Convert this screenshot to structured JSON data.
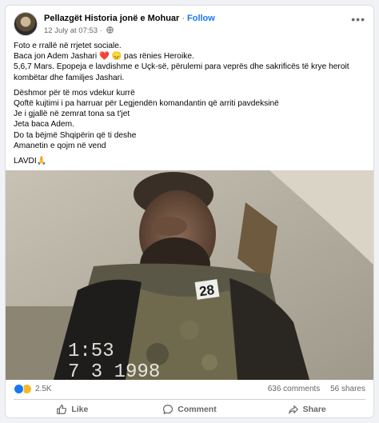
{
  "post": {
    "page_name": "Pellazgët Historia jonë e Mohuar",
    "separator": "·",
    "follow_label": "Follow",
    "timestamp": "12 July at 07:53",
    "meta_separator": "·",
    "more_icon": "more-horizontal-icon",
    "lines": [
      "Foto e rrallë në rrjetet sociale.",
      "Baca jon Adem Jashari ❤️ 😞 pas rënies Heroike.",
      "5,6,7 Mars. Epopeja e lavdishme e Uçk-së, përulemi para veprës dhe sakrificës të krye heroit",
      "kombëtar dhe familjes Jashari.",
      "",
      "Dëshmor për të mos vdekur kurrë",
      "Qoftë kujtimi i pa harruar për Legjendën komandantin që arriti pavdeksinë",
      "Je i gjallë në zemrat tona sa t'jet",
      "Jeta baca Adem.",
      "Do ta bëjmë Shqipërin që ti deshe",
      "Amanetin e qojm në vend",
      "",
      "LAVDI🙏"
    ],
    "photo": {
      "overlay_number": "28",
      "timestamp_line1": "1:53",
      "timestamp_line2": "7 3 1998"
    }
  },
  "stats": {
    "reaction_icons": [
      "like-reaction-icon",
      "sad-reaction-icon"
    ],
    "reaction_count": "2.5K",
    "comments": "636 comments",
    "shares": "56 shares"
  },
  "actions": {
    "like": "Like",
    "comment": "Comment",
    "share": "Share"
  },
  "colors": {
    "accent": "#1877f2",
    "secondary_text": "#65676b",
    "background": "#f0f2f5"
  }
}
